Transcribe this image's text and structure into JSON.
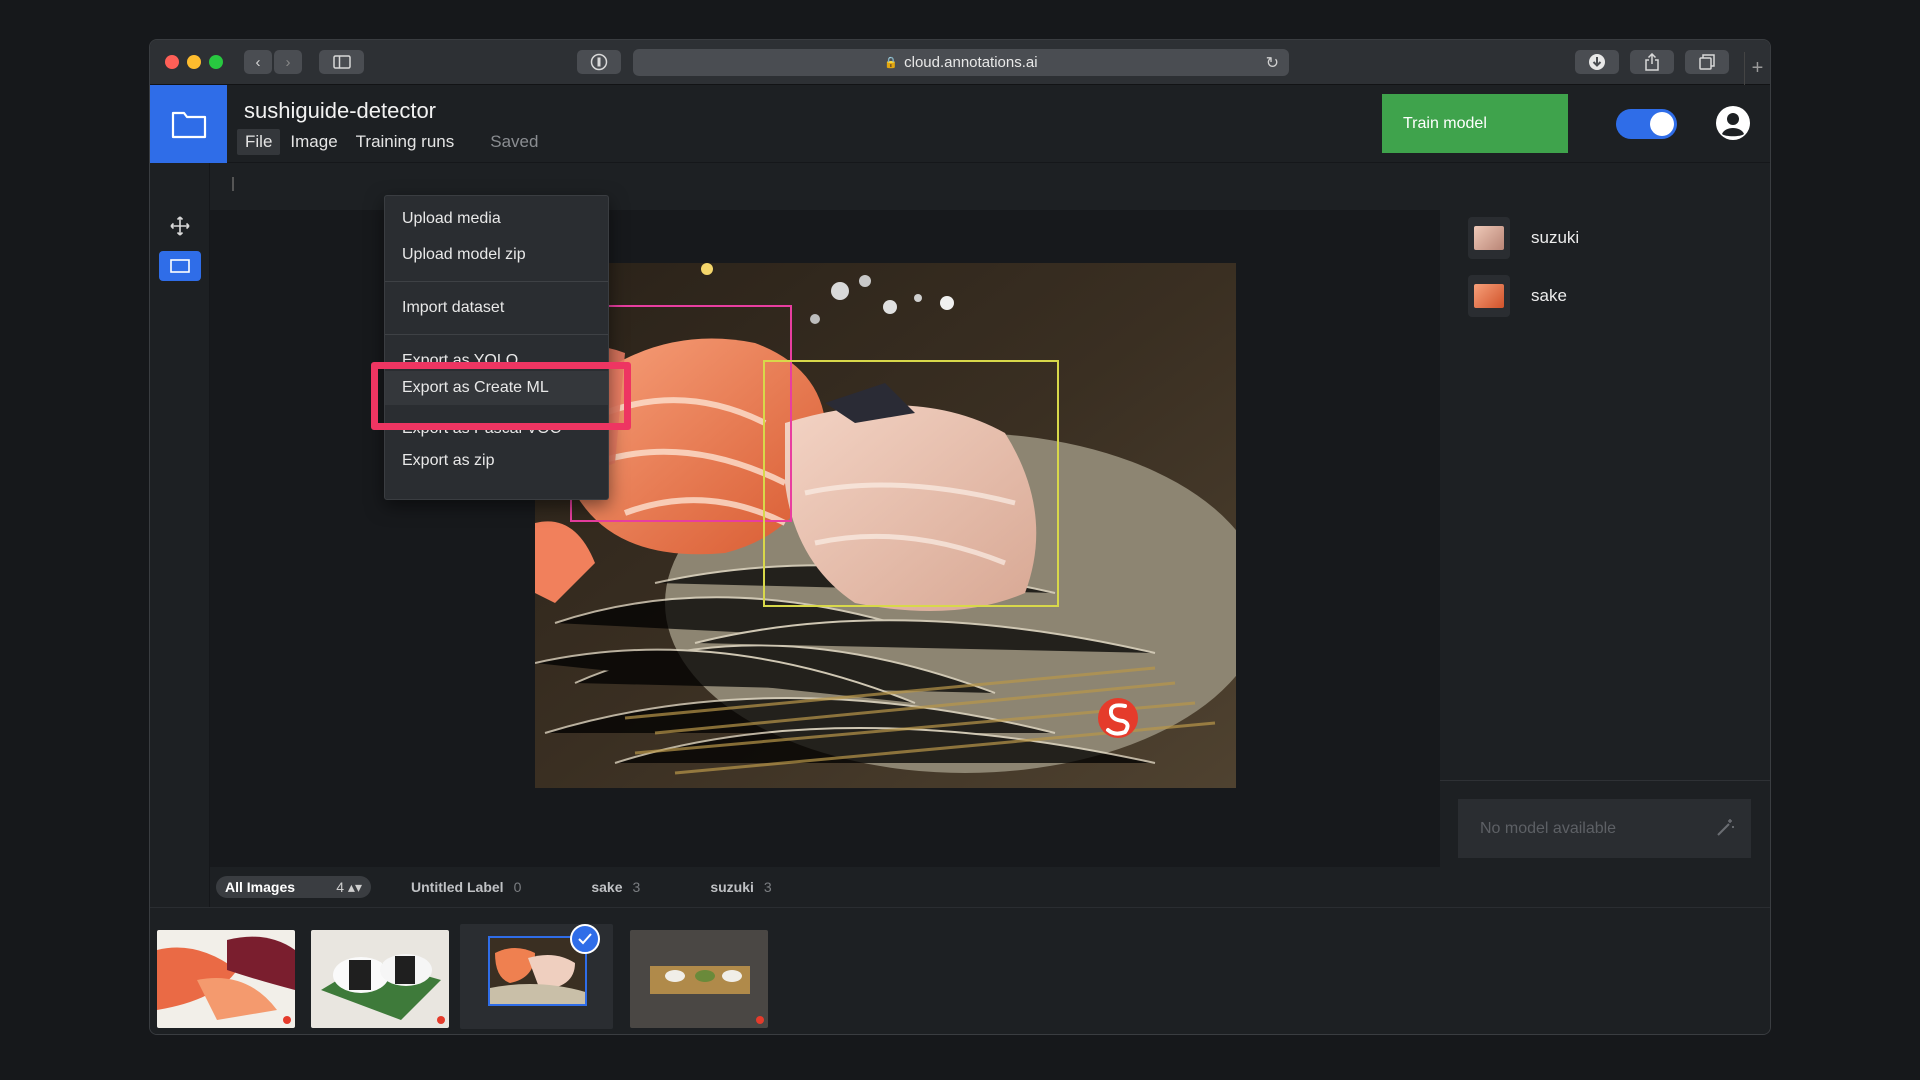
{
  "browser": {
    "url": "cloud.annotations.ai"
  },
  "app": {
    "project_title": "sushiguide-detector",
    "menu": [
      "File",
      "Image",
      "Training runs"
    ],
    "save_status": "Saved",
    "train_button": "Train model",
    "auto_label_toggle": "on"
  },
  "file_menu": {
    "items": [
      "Upload media",
      "Upload model zip",
      "Import dataset",
      "Export as YOLO",
      "Export as Create ML",
      "Export as Pascal VOC",
      "Export as zip"
    ],
    "highlighted": "Export as Create ML"
  },
  "tools": [
    "move-tool",
    "box-tool"
  ],
  "labels": [
    {
      "name": "suzuki",
      "color": "#d9a08e"
    },
    {
      "name": "sake",
      "color": "#e8743b"
    }
  ],
  "annotations": [
    {
      "label": "sake",
      "color": "#e83ea0"
    },
    {
      "label": "suzuki",
      "color": "#d8d84a"
    }
  ],
  "model_panel": {
    "placeholder": "No model available"
  },
  "filter_bar": {
    "selector": {
      "label": "All Images",
      "count": "4"
    },
    "chips": [
      {
        "label": "Untitled Label",
        "count": "0"
      },
      {
        "label": "sake",
        "count": "3"
      },
      {
        "label": "suzuki",
        "count": "3"
      }
    ]
  },
  "thumbnails": {
    "count": 4,
    "selected_index": 2
  },
  "colors": {
    "accent": "#2f6de8",
    "train": "#3fa34c",
    "callout": "#ee3562"
  }
}
